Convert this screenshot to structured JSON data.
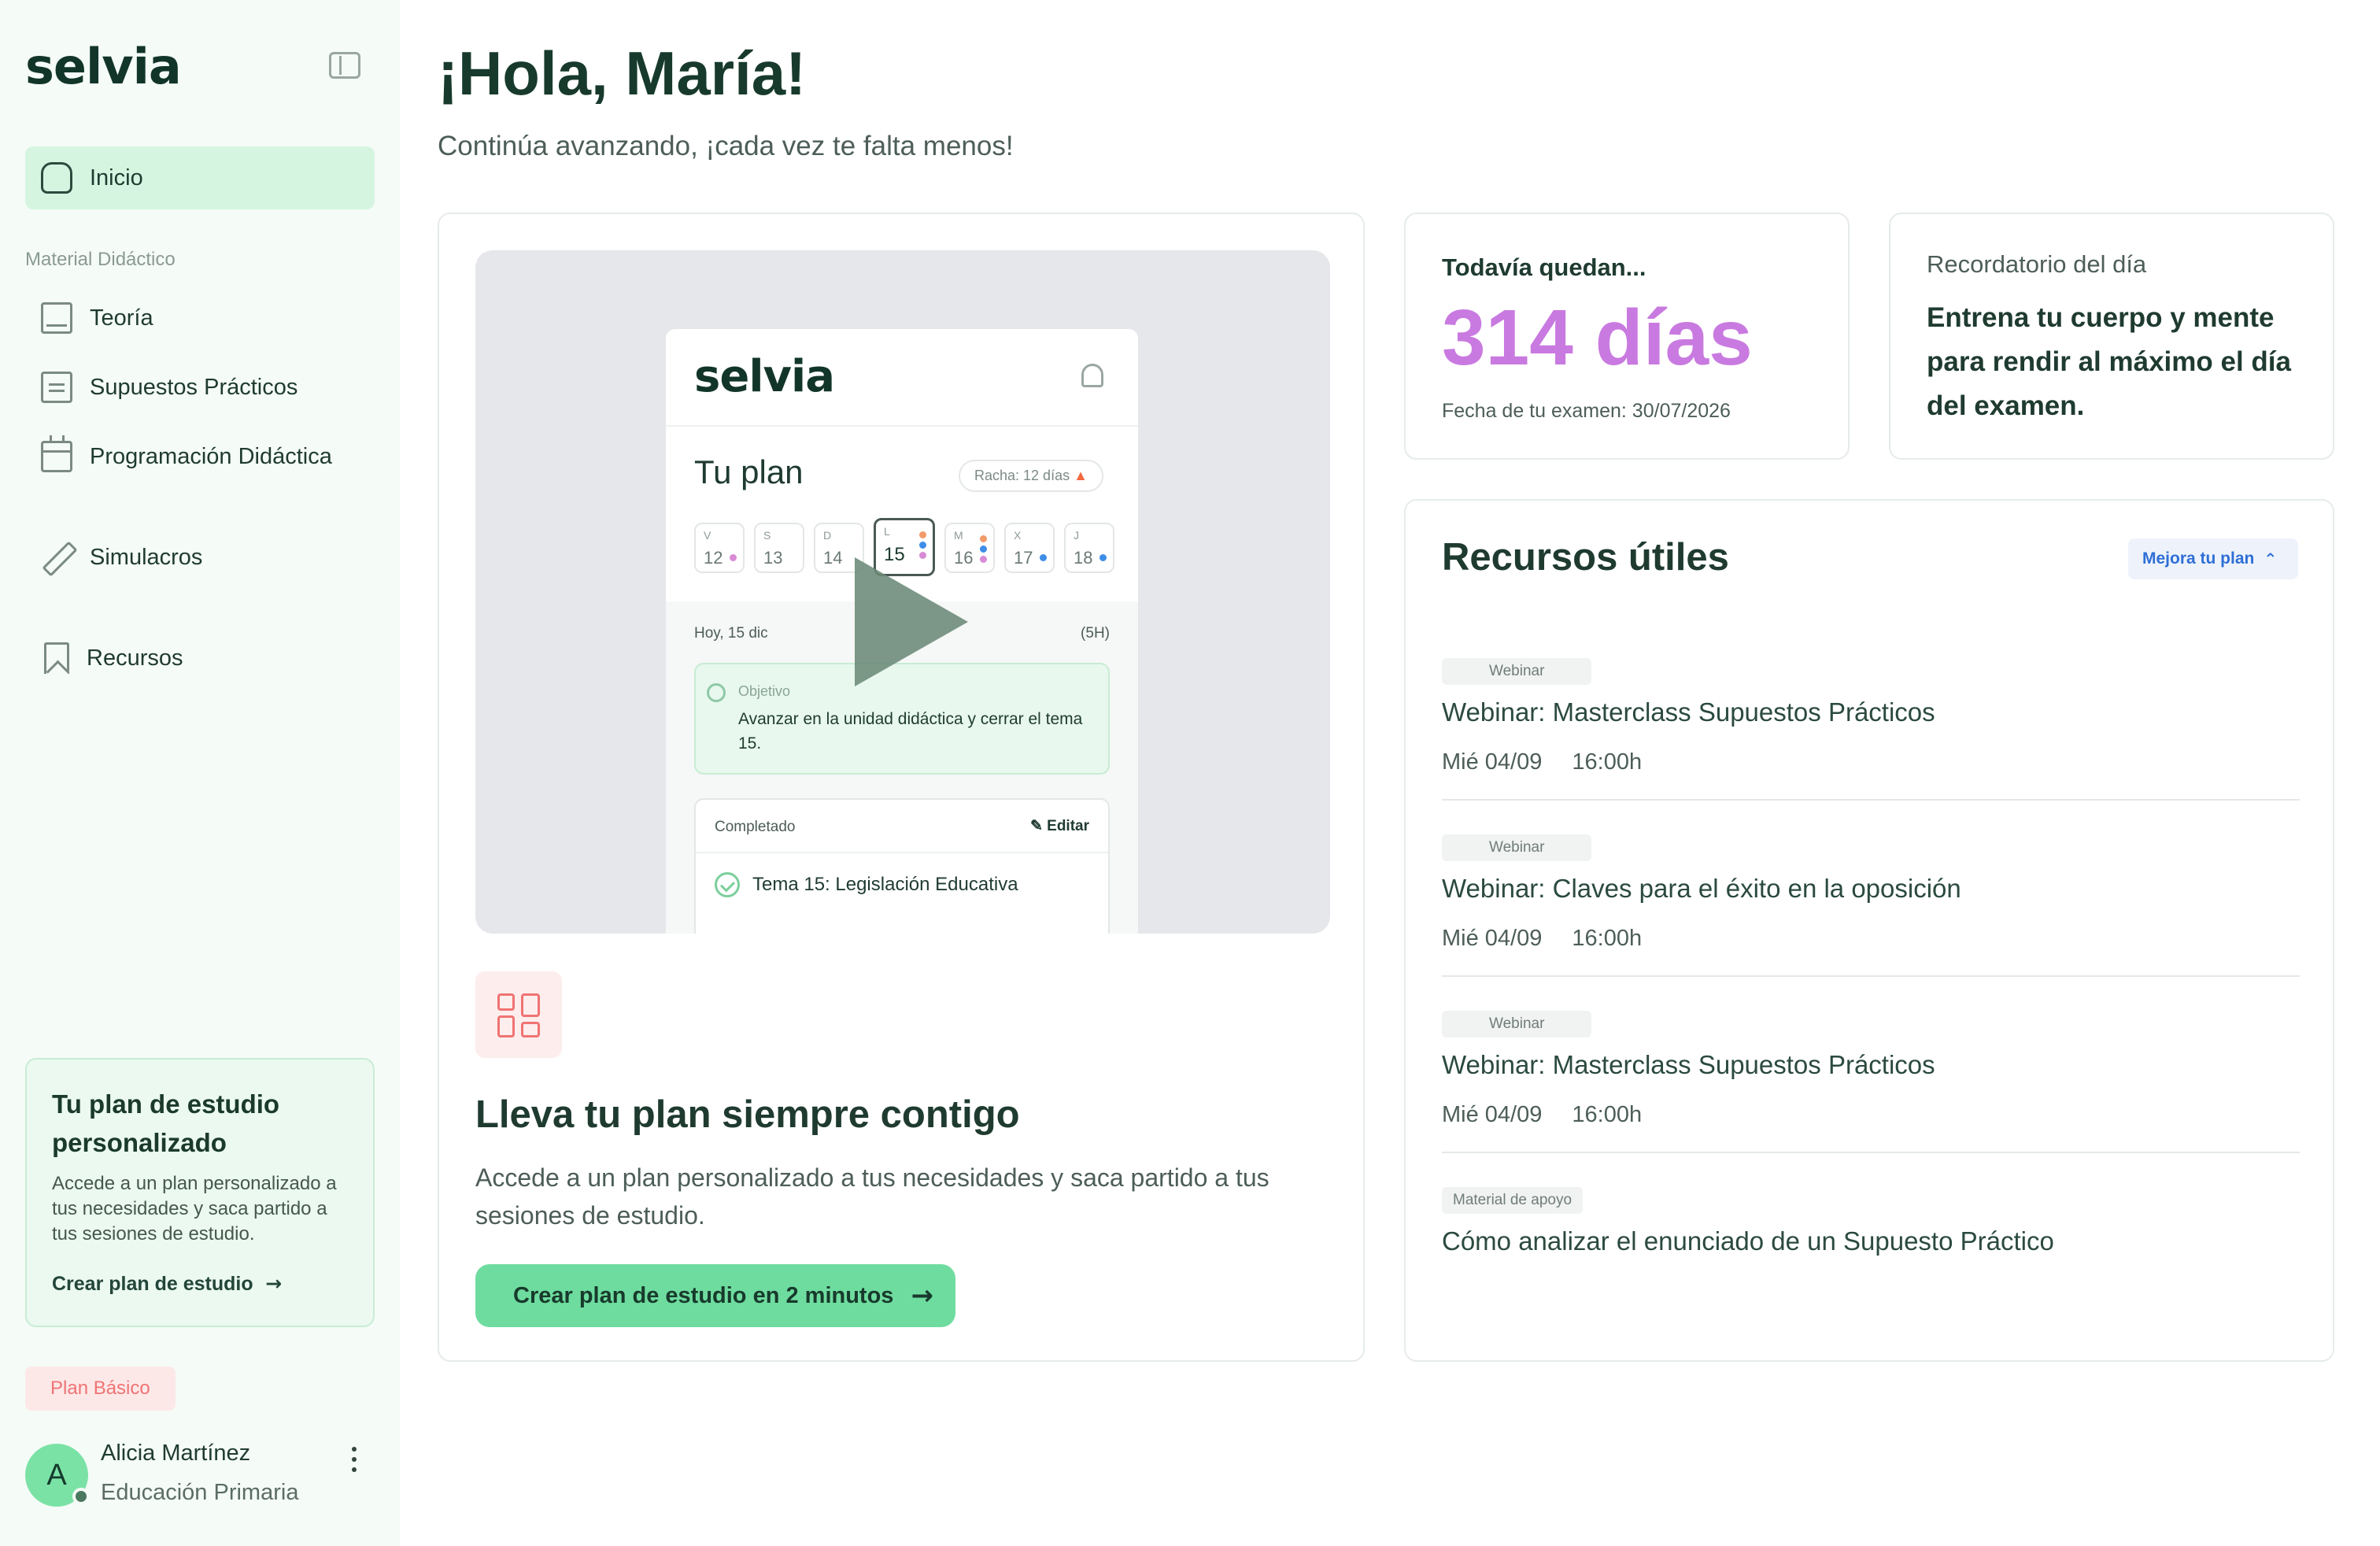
{
  "sidebar": {
    "logo": "selvia",
    "active_item": "Inicio",
    "section_label": "Material Didáctico",
    "items": [
      "Teoría",
      "Supuestos Prácticos",
      "Programación Didáctica"
    ],
    "simulacros": "Simulacros",
    "recursos": "Recursos",
    "plan_card": {
      "title": "Tu plan de estudio personalizado",
      "description": "Accede a un plan personalizado a tus necesidades y saca partido a tus sesiones de estudio.",
      "link": "Crear plan de estudio"
    },
    "plan_badge": "Plan Básico",
    "user": {
      "initial": "A",
      "name": "Alicia Martínez",
      "role": "Educación Primaria"
    }
  },
  "main": {
    "greeting": "¡Hola, María!",
    "subtitle": "Continúa avanzando, ¡cada vez te falta menos!",
    "hero": {
      "preview": {
        "logo": "selvia",
        "title": "Tu plan",
        "streak": "Racha: 12 días",
        "days": [
          {
            "letter": "V",
            "num": "12"
          },
          {
            "letter": "S",
            "num": "13"
          },
          {
            "letter": "D",
            "num": "14"
          },
          {
            "letter": "L",
            "num": "15"
          },
          {
            "letter": "M",
            "num": "16"
          },
          {
            "letter": "X",
            "num": "17"
          },
          {
            "letter": "J",
            "num": "18"
          }
        ],
        "today": "Hoy, 15 dic",
        "hours": "(5H)",
        "goal_label": "Objetivo",
        "goal_text": "Avanzar en la unidad didáctica y cerrar el tema 15.",
        "completed_label": "Completado",
        "edit_label": "Editar",
        "topic": "Tema 15: Legislación Educativa"
      },
      "title": "Lleva tu plan siempre contigo",
      "description": "Accede a un plan personalizado a tus necesidades y saca partido a tus sesiones de estudio.",
      "cta": "Crear plan de estudio en 2 minutos"
    },
    "countdown": {
      "label": "Todavía quedan...",
      "value": "314 días",
      "exam_date": "Fecha de tu examen: 30/07/2026"
    },
    "reminder": {
      "label": "Recordatorio del día",
      "text": "Entrena tu cuerpo y mente para rendir al máximo el día del examen."
    },
    "resources": {
      "title": "Recursos útiles",
      "button": "Mejora tu plan",
      "items": [
        {
          "tag": "Webinar",
          "title": "Webinar: Masterclass Supuestos Prácticos",
          "date": "Mié 04/09",
          "time": "16:00h"
        },
        {
          "tag": "Webinar",
          "title": "Webinar: Claves para el éxito en la oposición",
          "date": "Mié 04/09",
          "time": "16:00h"
        },
        {
          "tag": "Webinar",
          "title": "Webinar: Masterclass Supuestos Prácticos",
          "date": "Mié 04/09",
          "time": "16:00h"
        },
        {
          "tag": "Material de apoyo",
          "title": "Cómo analizar el enunciado de un Supuesto Práctico"
        }
      ]
    }
  },
  "colors": {
    "accent_green": "#6fdc9f",
    "active_nav": "#d6f5e1",
    "countdown_purple": "#c97ae0",
    "badge_red": "#f07373",
    "link_blue": "#2f6fd6"
  },
  "icons": [
    "collapse-sidebar-icon",
    "home-icon",
    "book-icon",
    "document-icon",
    "calendar-icon",
    "pencil-icon",
    "bookmark-icon",
    "arrow-right-icon",
    "kebab-menu-icon",
    "bell-icon",
    "flame-icon",
    "target-icon",
    "check-circle-icon",
    "play-icon",
    "layout-grid-icon",
    "chevrons-up-icon"
  ]
}
